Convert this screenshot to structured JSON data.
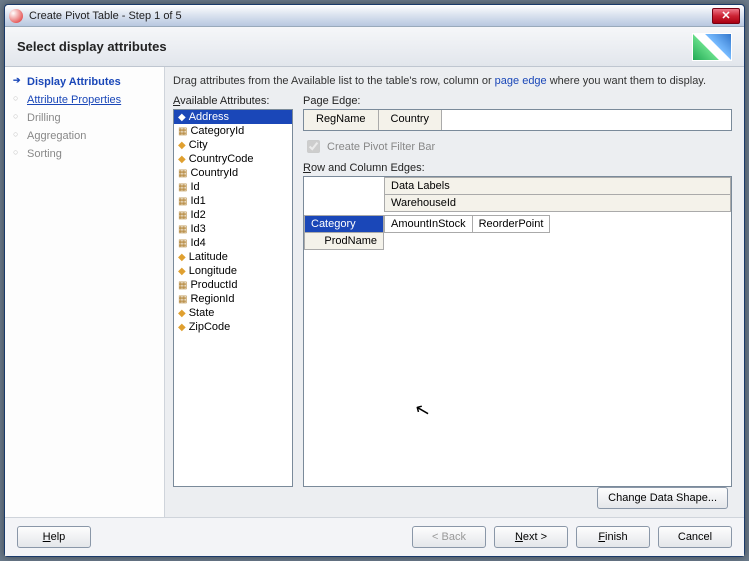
{
  "window": {
    "title": "Create Pivot Table - Step 1 of 5"
  },
  "header": {
    "title": "Select display attributes"
  },
  "sidebar": {
    "items": [
      {
        "label": "Display Attributes",
        "state": "active"
      },
      {
        "label": "Attribute Properties",
        "state": "link"
      },
      {
        "label": "Drilling",
        "state": "disabled"
      },
      {
        "label": "Aggregation",
        "state": "disabled"
      },
      {
        "label": "Sorting",
        "state": "disabled"
      }
    ]
  },
  "instruction": {
    "prefix": "Drag attributes from the Available list to the table's row, column or ",
    "link": "page edge",
    "suffix": " where you want them to display."
  },
  "labels": {
    "available": "Available Attributes:",
    "pageEdge": "Page Edge:",
    "createFilter": "Create Pivot Filter Bar",
    "rowCol": "Row and Column Edges:"
  },
  "available": [
    {
      "label": "Address",
      "icon": "diamond",
      "selected": true
    },
    {
      "label": "CategoryId",
      "icon": "key"
    },
    {
      "label": "City",
      "icon": "diamond"
    },
    {
      "label": "CountryCode",
      "icon": "diamond"
    },
    {
      "label": "CountryId",
      "icon": "key"
    },
    {
      "label": "Id",
      "icon": "key"
    },
    {
      "label": "Id1",
      "icon": "key"
    },
    {
      "label": "Id2",
      "icon": "key"
    },
    {
      "label": "Id3",
      "icon": "key"
    },
    {
      "label": "Id4",
      "icon": "key"
    },
    {
      "label": "Latitude",
      "icon": "diamond"
    },
    {
      "label": "Longitude",
      "icon": "diamond"
    },
    {
      "label": "ProductId",
      "icon": "key"
    },
    {
      "label": "RegionId",
      "icon": "key"
    },
    {
      "label": "State",
      "icon": "diamond"
    },
    {
      "label": "ZipCode",
      "icon": "diamond"
    }
  ],
  "pageEdge": [
    "RegName",
    "Country"
  ],
  "edges": {
    "colHeaders": [
      "Data Labels",
      "WarehouseId"
    ],
    "rowHeaders": [
      {
        "label": "Category",
        "selected": true
      },
      {
        "label": "ProdName",
        "selected": false
      }
    ],
    "dataCells": [
      "AmountInStock",
      "ReorderPoint"
    ]
  },
  "buttons": {
    "changeShape": "Change Data Shape...",
    "help": "Help",
    "back": "< Back",
    "next": "Next >",
    "finish": "Finish",
    "cancel": "Cancel"
  }
}
